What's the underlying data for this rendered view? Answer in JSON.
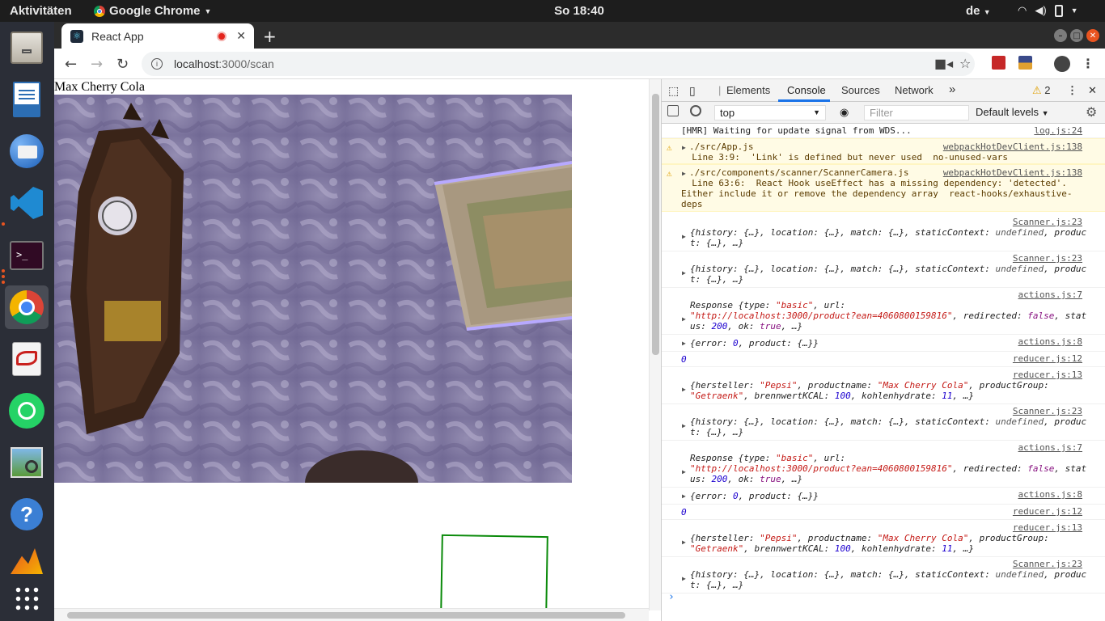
{
  "topbar": {
    "activities": "Aktivitäten",
    "app_menu": "Google Chrome",
    "clock": "So 18:40",
    "lang": "de"
  },
  "dock": {
    "items": [
      "files-icon",
      "writer-icon",
      "thunderbird-icon",
      "vscode-icon",
      "terminal-icon",
      "chrome-icon",
      "document-viewer-icon",
      "whatsapp-icon",
      "image-viewer-icon",
      "help-icon",
      "update-icon",
      "app-grid-icon"
    ]
  },
  "browser": {
    "tab_title": "React App",
    "url_host": "localhost",
    "url_path": ":3000/scan"
  },
  "page": {
    "title": "Max Cherry Cola"
  },
  "devtools": {
    "tabs": {
      "elements": "Elements",
      "console": "Console",
      "sources": "Sources",
      "network": "Network",
      "more": "»",
      "warn_count": "2"
    },
    "context": "top",
    "filter_placeholder": "Filter",
    "levels": "Default levels",
    "console": {
      "hmr": {
        "text": "[HMR] Waiting for update signal from WDS...",
        "src": "log.js:24"
      },
      "warn1": {
        "l1": "./src/App.js",
        "l2": "  Line 3:9:  'Link' is defined but never used  no-unused-vars",
        "src": "webpackHotDevClient.js:138"
      },
      "warn2": {
        "l1": "./src/components/scanner/ScannerCamera.js",
        "l2": "  Line 63:6:  React Hook useEffect has a missing dependency: 'detected'.",
        "l3": "Either include it or remove the dependency array  react-hooks/exhaustive-",
        "l4": "deps",
        "src": "webpackHotDevClient.js:138"
      },
      "scanner_src": "Scanner.js:23",
      "actions7_src": "actions.js:7",
      "actions8_src": "actions.js:8",
      "reducer12_src": "reducer.js:12",
      "reducer13_src": "reducer.js:13",
      "history_obj": {
        "a": "{history: {…}, location: {…}, match: {…}, staticContext: ",
        "b": "undefined",
        ",c": "",
        "c": ", produc",
        "d": "t: {…}, …}"
      },
      "response": {
        "a": "Response {type: ",
        "type": "\"basic\"",
        "b": ", url:",
        "url": "\"http://localhost:3000/product?ean=4060800159816\"",
        "c": ", redirected: ",
        "redirected": "false",
        "d": ", stat",
        "e": "us: ",
        "status": "200",
        "f": ", ok: ",
        "ok": "true",
        "g": ", …}"
      },
      "error_obj": {
        "a": "{error: ",
        "err": "0",
        "b": ", product: {…}}"
      },
      "zero": "0",
      "product": {
        "a": "{hersteller: ",
        "hersteller": "\"Pepsi\"",
        "b": ", productname: ",
        "name": "\"Max Cherry Cola\"",
        "c": ", productGroup:",
        "group": "\"Getraenk\"",
        "d": ", brennwertKCAL: ",
        "kcal": "100",
        "e": ", kohlenhydrate: ",
        "kh": "11",
        "f": ", …}"
      },
      "prompt": "›"
    }
  }
}
